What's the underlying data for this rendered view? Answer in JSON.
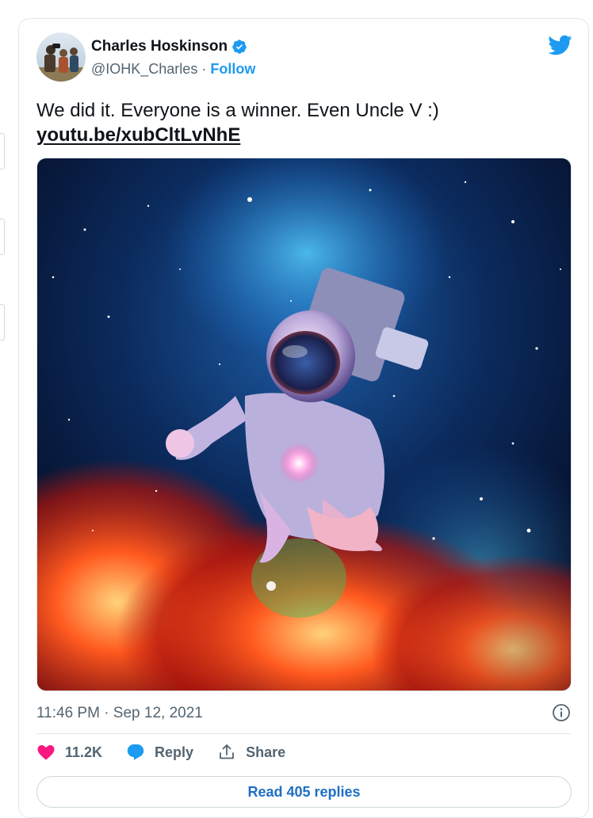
{
  "author": {
    "name": "Charles Hoskinson",
    "handle": "@IOHK_Charles",
    "separator": "·",
    "follow_label": "Follow"
  },
  "tweet": {
    "text": "We did it. Everyone is a winner. Even Uncle V :)",
    "link": "youtu.be/xubCltLvNhE",
    "timestamp": "11:46 PM · Sep 12, 2021"
  },
  "actions": {
    "likes": "11.2K",
    "reply_label": "Reply",
    "share_label": "Share",
    "read_replies_label": "Read 405 replies"
  },
  "colors": {
    "accent": "#1d9bf0",
    "like": "#f91880",
    "text": "#0f1419",
    "muted": "#536471"
  },
  "icons": [
    "verified-badge-icon",
    "twitter-bird-icon",
    "info-icon",
    "heart-icon",
    "reply-bubble-icon",
    "share-icon"
  ]
}
